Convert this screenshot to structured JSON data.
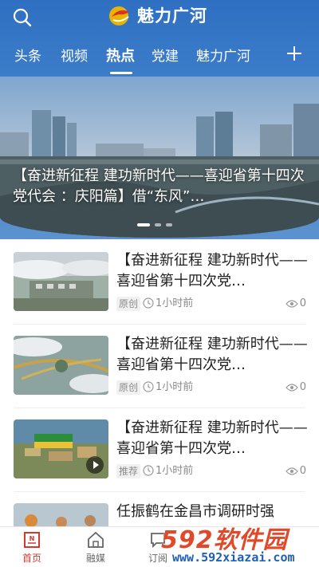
{
  "app": {
    "logo_text": "魅力广河"
  },
  "tabs": [
    {
      "label": "头条"
    },
    {
      "label": "视频"
    },
    {
      "label": "热点",
      "active": true
    },
    {
      "label": "党建"
    },
    {
      "label": "魅力广河"
    }
  ],
  "banner": {
    "caption": "【奋进新征程 建功新时代——喜迎省第十四次党代会 ：庆阳篇】借“东风”…",
    "slides_count": 3,
    "active_slide_index": 0
  },
  "news": [
    {
      "title": "【奋进新征程  建功新时代——喜迎省第十四次党…",
      "badge": "原创",
      "time": "1小时前",
      "views": "0"
    },
    {
      "title": "【奋进新征程  建功新时代——喜迎省第十四次党…",
      "badge": "原创",
      "time": "1小时前",
      "views": "0"
    },
    {
      "title": "【奋进新征程  建功新时代——喜迎省第十四次党…",
      "badge": "推荐",
      "time": "1小时前",
      "views": "0",
      "has_video": true
    },
    {
      "title": "任振鹤在金昌市调研时强"
    }
  ],
  "bottom_nav": [
    {
      "label": "首页",
      "icon": "news-icon",
      "active": true
    },
    {
      "label": "融媒",
      "icon": "home-icon"
    },
    {
      "label": "订阅",
      "icon": "subscribe-icon"
    }
  ],
  "watermark": {
    "brand": "592软件园",
    "url": "www.592xiazai.com"
  },
  "colors": {
    "header_blue": "#2f6fc2",
    "active_red": "#d23a2b",
    "watermark_red": "#e04a2a",
    "watermark_blue": "#1e5fb8"
  }
}
